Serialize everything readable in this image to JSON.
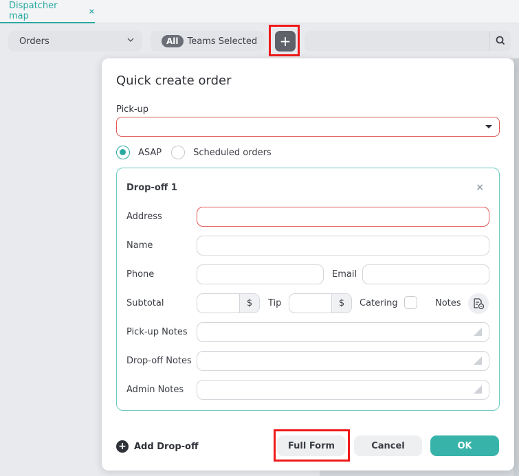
{
  "tabbar": {
    "tab_label": "Dispatcher map",
    "close_glyph": "×"
  },
  "toolbar": {
    "view_select_value": "Orders",
    "teams_badge": "All",
    "teams_label": "Teams Selected",
    "add_glyph": "+",
    "search_placeholder": ""
  },
  "modal": {
    "title": "Quick create order",
    "pickup_label": "Pick-up",
    "pickup_value": "",
    "schedule_options": [
      {
        "label": "ASAP",
        "selected": true
      },
      {
        "label": "Scheduled orders",
        "selected": false
      }
    ],
    "dropoff": {
      "title": "Drop-off 1",
      "close_glyph": "×",
      "fields": {
        "address": {
          "label": "Address",
          "value": ""
        },
        "name": {
          "label": "Name",
          "value": ""
        },
        "phone": {
          "label": "Phone",
          "value": ""
        },
        "email": {
          "label": "Email",
          "value": ""
        },
        "subtotal": {
          "label": "Subtotal",
          "value": "",
          "suffix": "$"
        },
        "tip": {
          "label": "Tip",
          "value": "",
          "suffix": "$"
        },
        "catering": {
          "label": "Catering",
          "checked": false
        },
        "notes": {
          "label": "Notes"
        },
        "pickup_notes": {
          "label": "Pick-up Notes",
          "value": ""
        },
        "dropoff_notes": {
          "label": "Drop-off Notes",
          "value": ""
        },
        "admin_notes": {
          "label": "Admin Notes",
          "value": ""
        }
      }
    },
    "add_dropoff_label": "Add Drop-off",
    "add_dropoff_glyph": "+",
    "buttons": {
      "full_form": "Full Form",
      "cancel": "Cancel",
      "ok": "OK"
    }
  },
  "colors": {
    "accent": "#2aa9a1",
    "error": "#e25656",
    "highlight": "#f01919",
    "ok_button": "#38b3aa"
  },
  "icons": [
    "close-icon",
    "chevron-down-icon",
    "plus-icon",
    "search-icon",
    "caret-down-icon",
    "notes-edit-icon",
    "resize-grip-icon"
  ]
}
